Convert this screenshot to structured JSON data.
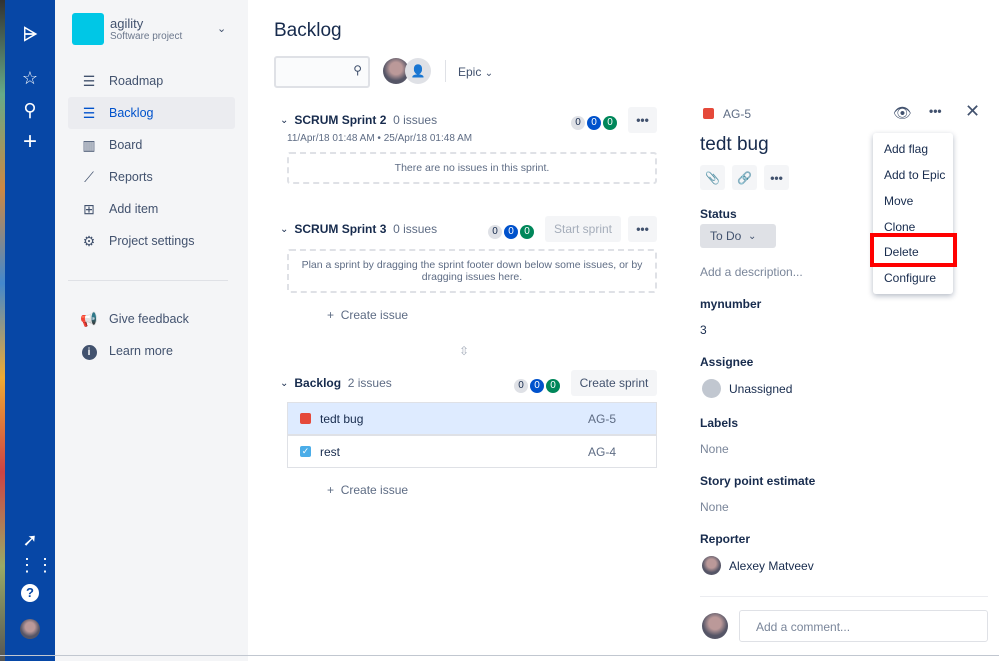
{
  "project": {
    "name": "agility",
    "type": "Software project"
  },
  "sidebar": {
    "items": [
      {
        "label": "Roadmap"
      },
      {
        "label": "Backlog"
      },
      {
        "label": "Board"
      },
      {
        "label": "Reports"
      },
      {
        "label": "Add item"
      },
      {
        "label": "Project settings"
      }
    ],
    "footer": [
      {
        "label": "Give feedback"
      },
      {
        "label": "Learn more"
      }
    ]
  },
  "main": {
    "title": "Backlog",
    "epic_filter": "Epic",
    "sprints": [
      {
        "name": "SCRUM Sprint 2",
        "count": "0 issues",
        "dates": "11/Apr/18 01:48 AM • 25/Apr/18 01:48 AM",
        "badges": [
          "0",
          "0",
          "0"
        ],
        "empty": "There are no issues in this sprint."
      },
      {
        "name": "SCRUM Sprint 3",
        "count": "0 issues",
        "badges": [
          "0",
          "0",
          "0"
        ],
        "action": "Start sprint",
        "empty": "Plan a sprint by dragging the sprint footer down below some issues, or by dragging issues here.",
        "create": "Create issue"
      }
    ],
    "backlog": {
      "name": "Backlog",
      "count": "2 issues",
      "badges": [
        "0",
        "0",
        "0"
      ],
      "action": "Create sprint",
      "create": "Create issue",
      "issues": [
        {
          "summary": "tedt bug",
          "key": "AG-5",
          "type": "bug"
        },
        {
          "summary": "rest",
          "key": "AG-4",
          "type": "task"
        }
      ]
    }
  },
  "detail": {
    "key": "AG-5",
    "title": "tedt bug",
    "status_label": "Status",
    "status": "To Do",
    "description_placeholder": "Add a description...",
    "fields": {
      "mynumber_label": "mynumber",
      "mynumber": "3",
      "assignee_label": "Assignee",
      "assignee": "Unassigned",
      "labels_label": "Labels",
      "labels": "None",
      "sp_label": "Story point estimate",
      "sp": "None",
      "reporter_label": "Reporter",
      "reporter": "Alexey Matveev"
    },
    "comment_placeholder": "Add a comment..."
  },
  "menu": {
    "items": [
      "Add flag",
      "Add to Epic",
      "Move",
      "Clone",
      "Delete",
      "Configure"
    ],
    "highlight_color": "#FF0000"
  }
}
